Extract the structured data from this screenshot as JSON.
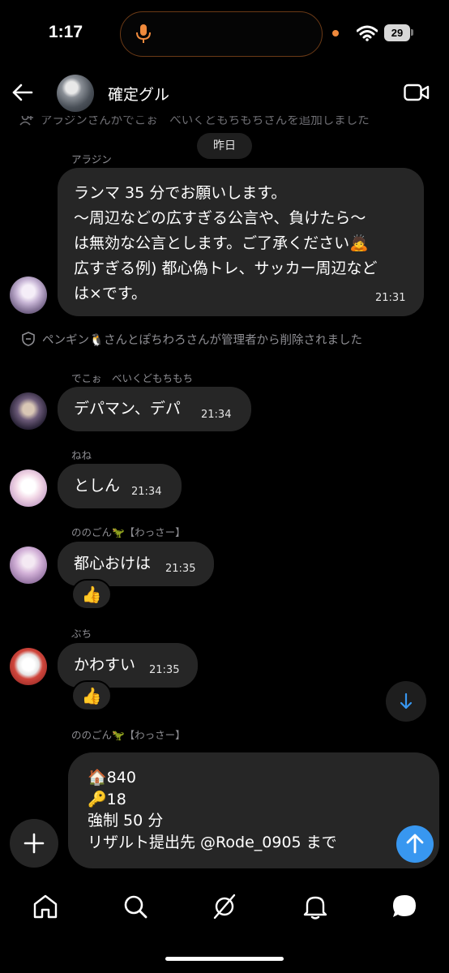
{
  "status_bar": {
    "time": "1:17",
    "battery": "29"
  },
  "header": {
    "title": "確定グル"
  },
  "system": {
    "top_partial": "アラジンさんがでこぉ　べいくどもちもちさんを追加しました",
    "date": "昨日",
    "removed": "ペンギン🐧さんとぽちわろさんが管理者から削除されました"
  },
  "messages": [
    {
      "sender": "アラジン",
      "lines": [
        "ランマ 35 分でお願いします。",
        "〜周辺などの広すぎる公言や、負けたら〜",
        "は無効な公言とします。ご了承ください🙇",
        "広すぎる例) 都心偽トレ、サッカー周辺など",
        "は×です。"
      ],
      "time": "21:31"
    },
    {
      "sender": "でこぉ　べいくどもちもち",
      "text": "デパマン、デパ",
      "time": "21:34"
    },
    {
      "sender": "ねね",
      "text": "としん",
      "time": "21:34"
    },
    {
      "sender": "ののごん🦖【わっさー】",
      "text": "都心おけは",
      "time": "21:35",
      "reaction": "👍"
    },
    {
      "sender": "ぶち",
      "text": "かわすい",
      "time": "21:35",
      "reaction": "👍"
    }
  ],
  "composer": {
    "sender_label": "ののごん🦖【わっさー】",
    "draft": "🏠840\n🔑18\n強制 50 分\nリザルト提出先 @Rode_0905 まで"
  },
  "nav": [
    "home-icon",
    "search-icon",
    "explore-icon",
    "notifications-icon",
    "messages-icon"
  ]
}
